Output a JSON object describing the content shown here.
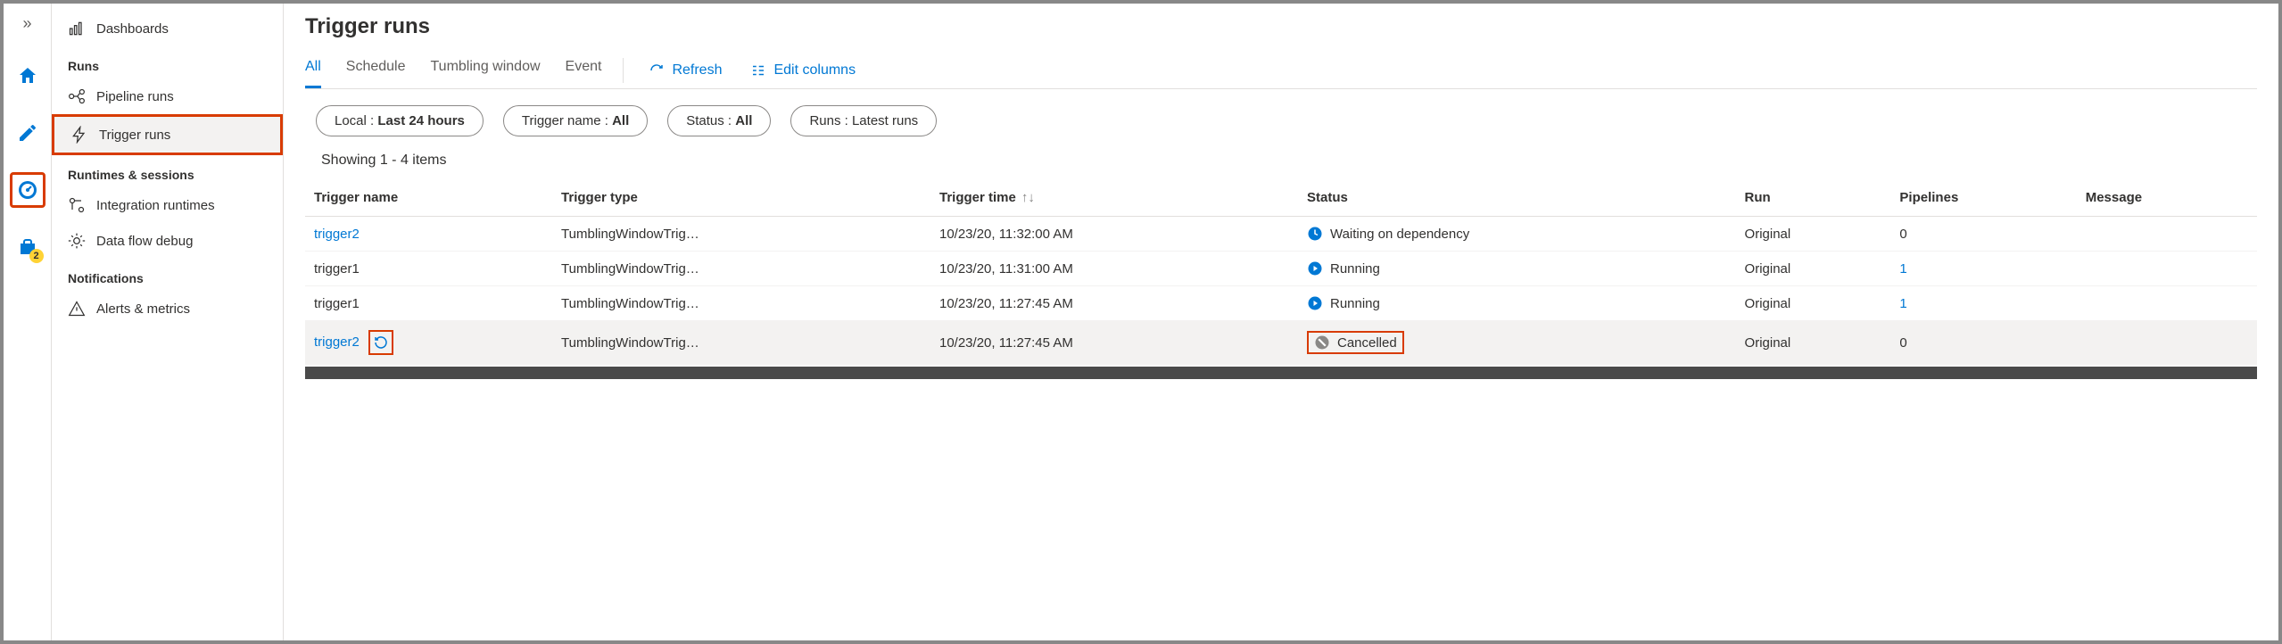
{
  "rail": {
    "expand_glyph": "»",
    "badge": "2"
  },
  "sidebar": {
    "dashboards": "Dashboards",
    "section_runs": "Runs",
    "pipeline_runs": "Pipeline runs",
    "trigger_runs": "Trigger runs",
    "section_runtimes": "Runtimes & sessions",
    "integration_runtimes": "Integration runtimes",
    "data_flow_debug": "Data flow debug",
    "section_notifications": "Notifications",
    "alerts_metrics": "Alerts & metrics"
  },
  "header": {
    "title": "Trigger runs"
  },
  "tabs": {
    "all": "All",
    "schedule": "Schedule",
    "tumbling": "Tumbling window",
    "event": "Event"
  },
  "toolbar": {
    "refresh": "Refresh",
    "edit_columns": "Edit columns"
  },
  "filters": {
    "local_label": "Local : ",
    "local_value": "Last 24 hours",
    "trigger_label": "Trigger name : ",
    "trigger_value": "All",
    "status_label": "Status : ",
    "status_value": "All",
    "runs_label": "Runs : ",
    "runs_value": "Latest runs"
  },
  "showing": "Showing 1 - 4 items",
  "columns": {
    "trigger_name": "Trigger name",
    "trigger_type": "Trigger type",
    "trigger_time": "Trigger time",
    "status": "Status",
    "run": "Run",
    "pipelines": "Pipelines",
    "message": "Message"
  },
  "rows": [
    {
      "name": "trigger2",
      "name_link": true,
      "type": "TumblingWindowTrig…",
      "time": "10/23/20, 11:32:00 AM",
      "status": "Waiting on dependency",
      "status_kind": "waiting",
      "run": "Original",
      "pipelines": "0",
      "pipelines_link": false,
      "rerun": false,
      "hover": false,
      "status_box": false
    },
    {
      "name": "trigger1",
      "name_link": false,
      "type": "TumblingWindowTrig…",
      "time": "10/23/20, 11:31:00 AM",
      "status": "Running",
      "status_kind": "running",
      "run": "Original",
      "pipelines": "1",
      "pipelines_link": true,
      "rerun": false,
      "hover": false,
      "status_box": false
    },
    {
      "name": "trigger1",
      "name_link": false,
      "type": "TumblingWindowTrig…",
      "time": "10/23/20, 11:27:45 AM",
      "status": "Running",
      "status_kind": "running",
      "run": "Original",
      "pipelines": "1",
      "pipelines_link": true,
      "rerun": false,
      "hover": false,
      "status_box": false
    },
    {
      "name": "trigger2",
      "name_link": true,
      "type": "TumblingWindowTrig…",
      "time": "10/23/20, 11:27:45 AM",
      "status": "Cancelled",
      "status_kind": "cancelled",
      "run": "Original",
      "pipelines": "0",
      "pipelines_link": false,
      "rerun": true,
      "hover": true,
      "status_box": true
    }
  ]
}
